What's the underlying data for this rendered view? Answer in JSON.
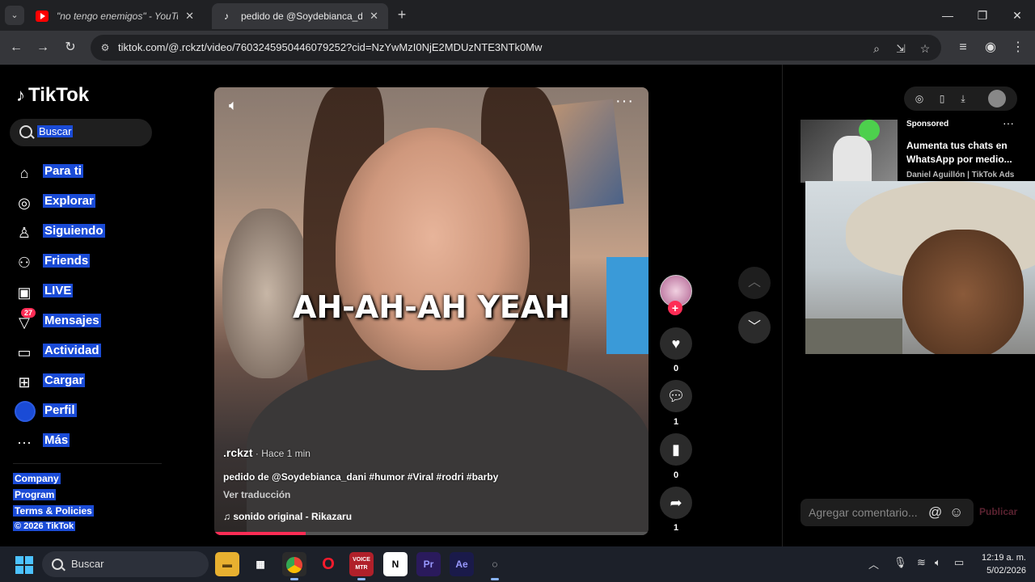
{
  "browser": {
    "tabs": [
      {
        "title": "\"no tengo enemigos\" - YouTube",
        "active": false
      },
      {
        "title": "pedido de @Soydebianca_dani",
        "active": true
      }
    ],
    "url": "tiktok.com/@.rckzt/video/7603245950446079252?cid=NzYwMzI0NjE2MDUzNTE3NTk0Mw"
  },
  "tiktok": {
    "logo": "TikTok",
    "search_placeholder": "Buscar",
    "nav": [
      {
        "label": "Para ti",
        "icon": "home-icon"
      },
      {
        "label": "Explorar",
        "icon": "compass-icon"
      },
      {
        "label": "Siguiendo",
        "icon": "following-icon"
      },
      {
        "label": "Friends",
        "icon": "friends-icon"
      },
      {
        "label": "LIVE",
        "icon": "live-icon"
      },
      {
        "label": "Mensajes",
        "icon": "messages-icon",
        "badge": "27"
      },
      {
        "label": "Actividad",
        "icon": "activity-icon"
      },
      {
        "label": "Cargar",
        "icon": "upload-icon"
      },
      {
        "label": "Perfil",
        "icon": "profile-avatar"
      },
      {
        "label": "Más",
        "icon": "more-icon"
      }
    ],
    "footer": {
      "company": "Company",
      "program": "Program",
      "terms": "Terms & Policies",
      "copyright": "© 2026 TikTok"
    },
    "video": {
      "overlay_text": "AH-AH-AH YEAH",
      "author": ".rckzt",
      "time": " · Hace 1 min",
      "description": "pedido de @Soydebianca_dani #humor #Viral #rodri #barby",
      "translate": "Ver traducción",
      "sound": "♫  sonido original - Rikazaru",
      "progress": 0.21
    },
    "actions": {
      "likes": "0",
      "comments": "1",
      "saves": "0",
      "shares": "1"
    },
    "ad": {
      "sponsored": "Sponsored",
      "title": "Aumenta tus chats en WhatsApp por medio...",
      "by": "Daniel Aguillón | TikTok Ads"
    },
    "comment_placeholder": "Agregar comentario...",
    "publish": "Publicar"
  },
  "taskbar": {
    "search": "Buscar",
    "time": "12:19 a. m.",
    "date": "5/02/2026"
  }
}
